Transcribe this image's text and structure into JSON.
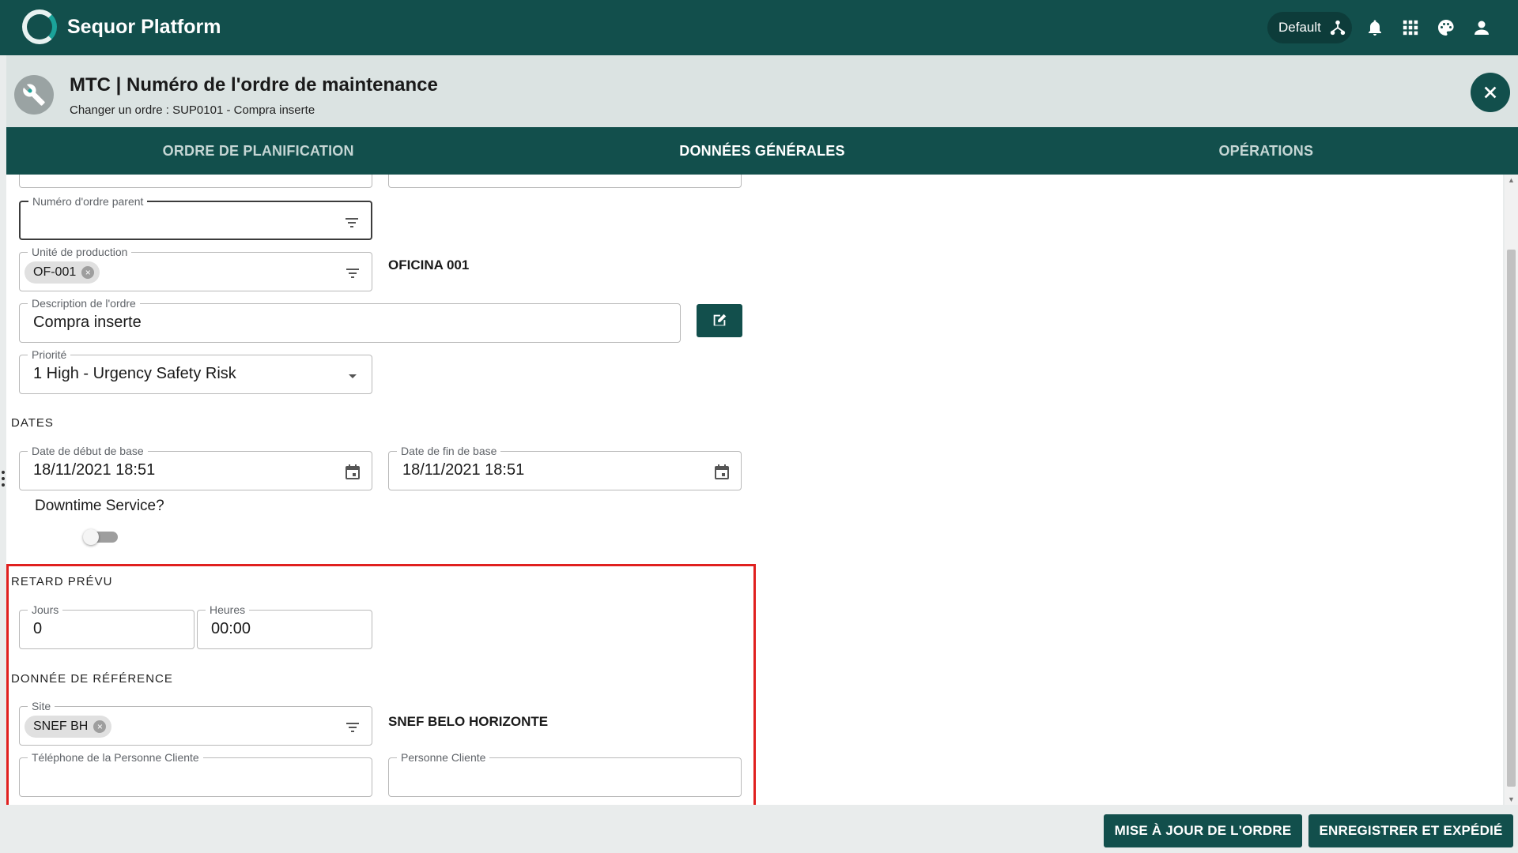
{
  "app": {
    "title": "Sequor Platform",
    "env_label": "Default"
  },
  "header": {
    "title": "MTC | Numéro de l'ordre de maintenance",
    "subtitle": "Changer un ordre : SUP0101 - Compra inserte"
  },
  "tabs": [
    {
      "label": "ORDRE DE PLANIFICATION"
    },
    {
      "label": "DONNÉES GÉNÉRALES"
    },
    {
      "label": "OPÉRATIONS"
    }
  ],
  "form": {
    "parent_order": {
      "label": "Numéro d'ordre parent",
      "value": ""
    },
    "production_unit": {
      "label": "Unité de production",
      "chip": "OF-001",
      "description": "OFICINA 001"
    },
    "order_description": {
      "label": "Description de l'ordre",
      "value": "Compra inserte"
    },
    "priority": {
      "label": "Priorité",
      "value": "1 High - Urgency Safety Risk"
    },
    "dates_section": "DATES",
    "start_date": {
      "label": "Date de début de base",
      "value": "18/11/2021 18:51"
    },
    "end_date": {
      "label": "Date de fin de base",
      "value": "18/11/2021 18:51"
    },
    "downtime": {
      "label": "Downtime Service?",
      "on": false
    },
    "delay_section": "RETARD PRÉVU",
    "days": {
      "label": "Jours",
      "value": "0"
    },
    "hours": {
      "label": "Heures",
      "value": "00:00"
    },
    "reference_section": "DONNÉE DE RÉFÉRENCE",
    "site": {
      "label": "Site",
      "chip": "SNEF BH",
      "description": "SNEF BELO HORIZONTE"
    },
    "client_phone": {
      "label": "Téléphone de la Personne Cliente",
      "value": ""
    },
    "client_person": {
      "label": "Personne Cliente",
      "value": ""
    }
  },
  "footer": {
    "update_label": "MISE À JOUR DE L'ORDRE",
    "save_label": "ENREGISTRER ET EXPÉDIÉ"
  },
  "colors": {
    "primary": "#124f4c",
    "highlight": "#e0201f"
  }
}
